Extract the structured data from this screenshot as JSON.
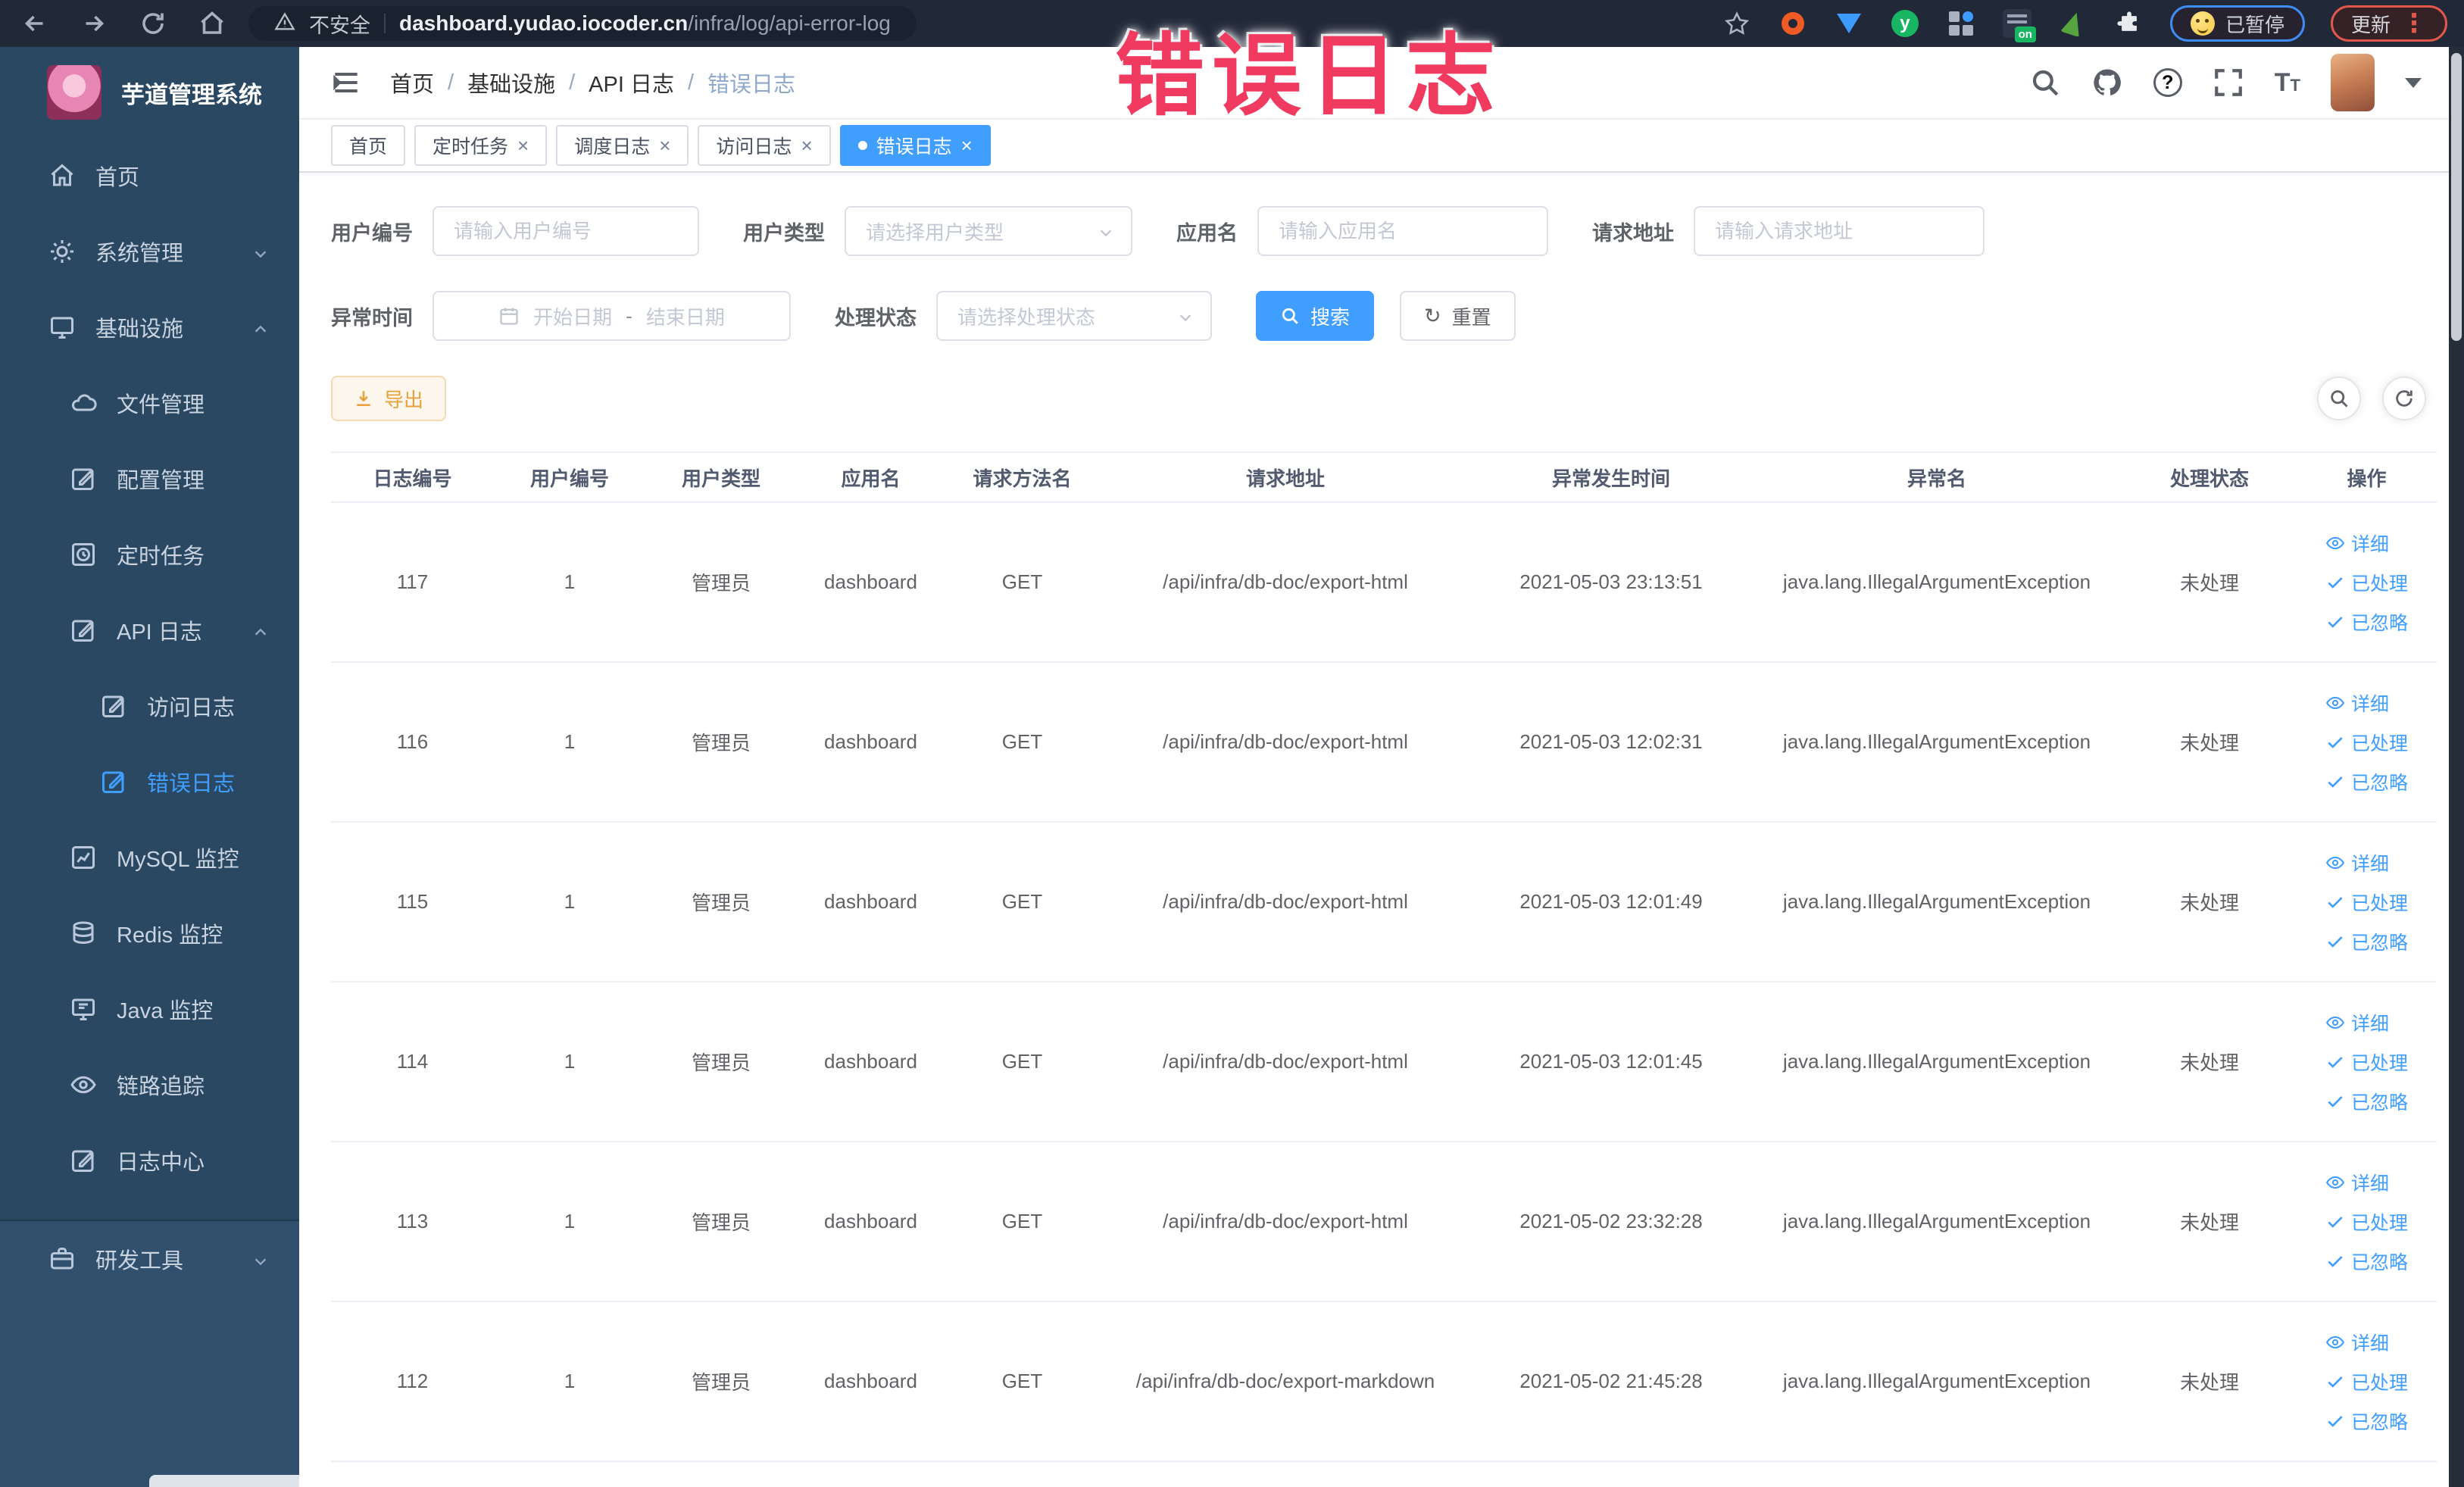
{
  "browser": {
    "security_label": "不安全",
    "url_host": "dashboard.yudao.iocoder.cn",
    "url_path": "/infra/log/api-error-log",
    "paused_badge": "已暂停",
    "update_badge": "更新",
    "menu_dots": "⋮",
    "extension_icons": [
      "bookmark-star-icon",
      "orange-ring-extension-icon",
      "blue-extension-icon",
      "green-y-extension-icon",
      "grid-extension-icon",
      "on-switch-extension-icon",
      "leaf-extension-icon",
      "puzzle-extensions-icon"
    ]
  },
  "watermark": "错误日志",
  "colors": {
    "accent": "#409eff",
    "warning": "#e6a23c",
    "watermark": "#f03a60",
    "sidebar_bg": "#2b4863"
  },
  "sidebar": {
    "title": "芋道管理系统",
    "menu": [
      {
        "label": "首页"
      },
      {
        "label": "系统管理"
      },
      {
        "label": "基础设施"
      },
      {
        "label": "文件管理"
      },
      {
        "label": "配置管理"
      },
      {
        "label": "定时任务"
      },
      {
        "label": "API 日志"
      },
      {
        "label": "访问日志"
      },
      {
        "label": "错误日志"
      },
      {
        "label": "MySQL 监控"
      },
      {
        "label": "Redis 监控"
      },
      {
        "label": "Java 监控"
      },
      {
        "label": "链路追踪"
      },
      {
        "label": "日志中心"
      },
      {
        "label": "研发工具"
      }
    ]
  },
  "header": {
    "breadcrumb": [
      "首页",
      "基础设施",
      "API 日志",
      "错误日志"
    ],
    "separator": "/"
  },
  "tabs": [
    {
      "label": "首页"
    },
    {
      "label": "定时任务"
    },
    {
      "label": "调度日志"
    },
    {
      "label": "访问日志"
    },
    {
      "label": "错误日志"
    }
  ],
  "filters": {
    "user_id": {
      "label": "用户编号",
      "placeholder": "请输入用户编号"
    },
    "user_type": {
      "label": "用户类型",
      "placeholder": "请选择用户类型"
    },
    "app_name": {
      "label": "应用名",
      "placeholder": "请输入应用名"
    },
    "request_url": {
      "label": "请求地址",
      "placeholder": "请输入请求地址"
    },
    "exception_time": {
      "label": "异常时间",
      "start_placeholder": "开始日期",
      "separator": "-",
      "end_placeholder": "结束日期"
    },
    "process_status": {
      "label": "处理状态",
      "placeholder": "请选择处理状态"
    },
    "search_button": "搜索",
    "reset_button": "重置"
  },
  "toolbar": {
    "export_button": "导出"
  },
  "table": {
    "columns": [
      "日志编号",
      "用户编号",
      "用户类型",
      "应用名",
      "请求方法名",
      "请求地址",
      "异常发生时间",
      "异常名",
      "处理状态",
      "操作"
    ],
    "actions": [
      "详细",
      "已处理",
      "已忽略"
    ],
    "rows": [
      {
        "id": "117",
        "user_id": "1",
        "user_type": "管理员",
        "app": "dashboard",
        "method": "GET",
        "url": "/api/infra/db-doc/export-html",
        "time": "2021-05-03 23:13:51",
        "exception": "java.lang.IllegalArgumentException",
        "status": "未处理"
      },
      {
        "id": "116",
        "user_id": "1",
        "user_type": "管理员",
        "app": "dashboard",
        "method": "GET",
        "url": "/api/infra/db-doc/export-html",
        "time": "2021-05-03 12:02:31",
        "exception": "java.lang.IllegalArgumentException",
        "status": "未处理"
      },
      {
        "id": "115",
        "user_id": "1",
        "user_type": "管理员",
        "app": "dashboard",
        "method": "GET",
        "url": "/api/infra/db-doc/export-html",
        "time": "2021-05-03 12:01:49",
        "exception": "java.lang.IllegalArgumentException",
        "status": "未处理"
      },
      {
        "id": "114",
        "user_id": "1",
        "user_type": "管理员",
        "app": "dashboard",
        "method": "GET",
        "url": "/api/infra/db-doc/export-html",
        "time": "2021-05-03 12:01:45",
        "exception": "java.lang.IllegalArgumentException",
        "status": "未处理"
      },
      {
        "id": "113",
        "user_id": "1",
        "user_type": "管理员",
        "app": "dashboard",
        "method": "GET",
        "url": "/api/infra/db-doc/export-html",
        "time": "2021-05-02 23:32:28",
        "exception": "java.lang.IllegalArgumentException",
        "status": "未处理"
      },
      {
        "id": "112",
        "user_id": "1",
        "user_type": "管理员",
        "app": "dashboard",
        "method": "GET",
        "url": "/api/infra/db-doc/export-markdown",
        "time": "2021-05-02 21:45:28",
        "exception": "java.lang.IllegalArgumentException",
        "status": "未处理"
      }
    ]
  }
}
